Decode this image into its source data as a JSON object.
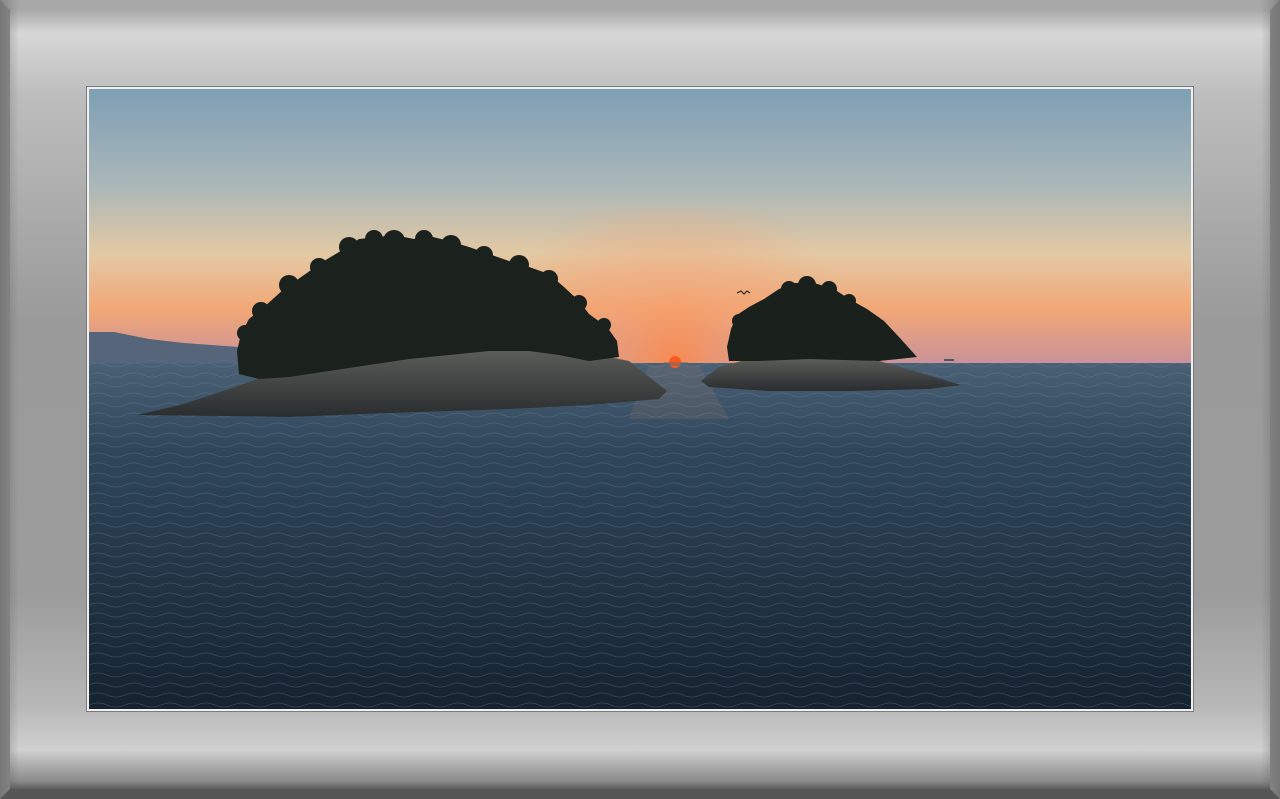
{
  "image": {
    "description_colors": {
      "sky_top": "#7fa0b6",
      "sky_mid": "#c9c3b2",
      "sky_horizon": "#f0a373",
      "sun": "#ff6a2a",
      "sea_near": "#1a2a38",
      "sea_far": "#3d5468",
      "island": "#1e2420",
      "frame": "#9c9c9c"
    },
    "icons": [
      "sun-icon",
      "bird-icon"
    ]
  }
}
